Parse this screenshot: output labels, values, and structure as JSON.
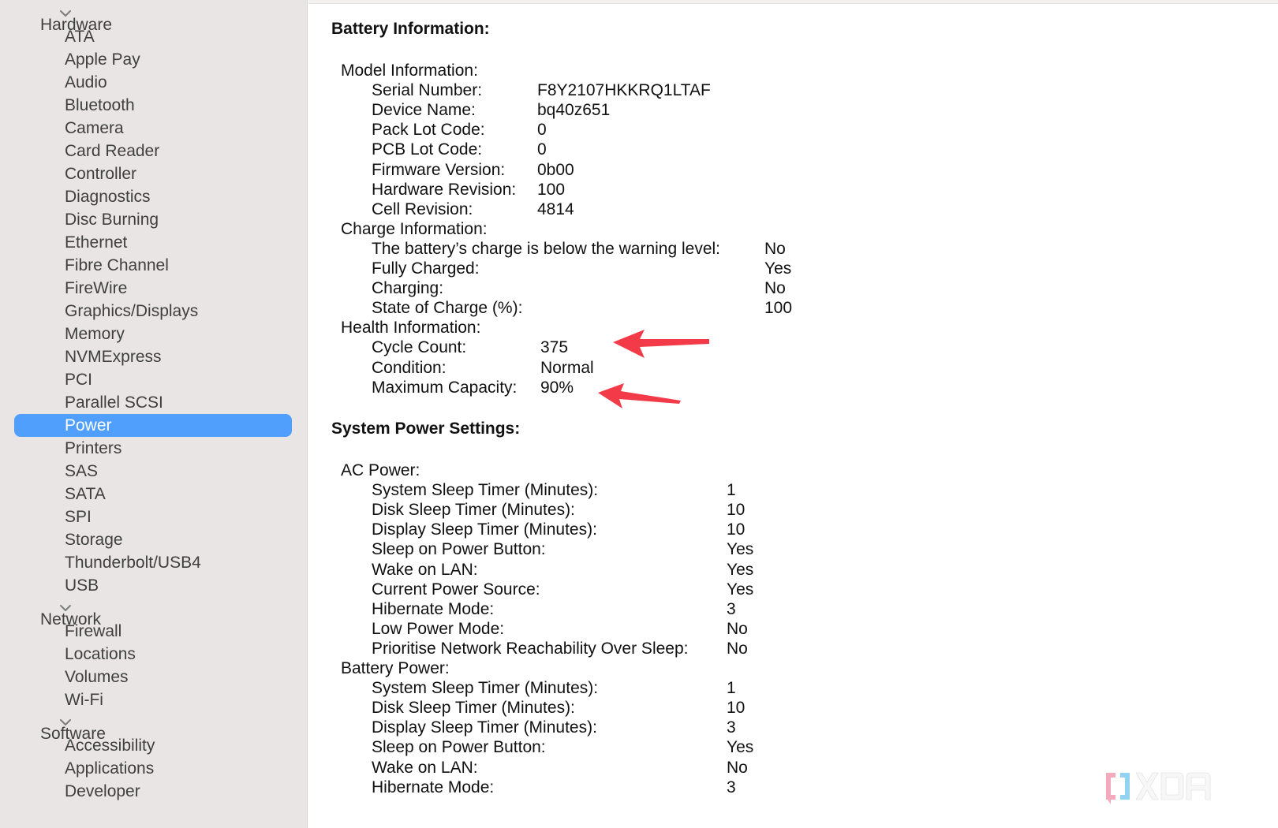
{
  "sidebar": {
    "groups": [
      {
        "label": "Hardware",
        "expanded": true,
        "items": [
          "ATA",
          "Apple Pay",
          "Audio",
          "Bluetooth",
          "Camera",
          "Card Reader",
          "Controller",
          "Diagnostics",
          "Disc Burning",
          "Ethernet",
          "Fibre Channel",
          "FireWire",
          "Graphics/Displays",
          "Memory",
          "NVMExpress",
          "PCI",
          "Parallel SCSI",
          "Power",
          "Printers",
          "SAS",
          "SATA",
          "SPI",
          "Storage",
          "Thunderbolt/USB4",
          "USB"
        ]
      },
      {
        "label": "Network",
        "expanded": true,
        "items": [
          "Firewall",
          "Locations",
          "Volumes",
          "Wi-Fi"
        ]
      },
      {
        "label": "Software",
        "expanded": true,
        "items": [
          "Accessibility",
          "Applications",
          "Developer"
        ]
      }
    ],
    "selected": "Power",
    "selection_color": "#509ffc"
  },
  "battery": {
    "title": "Battery Information:",
    "model": {
      "heading": "Model Information:",
      "rows": [
        {
          "label": "Serial Number:",
          "value": "F8Y2107HKKRQ1LTAF"
        },
        {
          "label": "Device Name:",
          "value": "bq40z651"
        },
        {
          "label": "Pack Lot Code:",
          "value": "0"
        },
        {
          "label": "PCB Lot Code:",
          "value": "0"
        },
        {
          "label": "Firmware Version:",
          "value": "0b00"
        },
        {
          "label": "Hardware Revision:",
          "value": "100"
        },
        {
          "label": "Cell Revision:",
          "value": "4814"
        }
      ]
    },
    "charge": {
      "heading": "Charge Information:",
      "rows": [
        {
          "label": "The battery’s charge is below the warning level:",
          "value": "No"
        },
        {
          "label": "Fully Charged:",
          "value": "Yes"
        },
        {
          "label": "Charging:",
          "value": "No"
        },
        {
          "label": "State of Charge (%):",
          "value": "100"
        }
      ]
    },
    "health": {
      "heading": "Health Information:",
      "rows": [
        {
          "label": "Cycle Count:",
          "value": "375"
        },
        {
          "label": "Condition:",
          "value": "Normal"
        },
        {
          "label": "Maximum Capacity:",
          "value": "90%"
        }
      ]
    }
  },
  "power_settings": {
    "title": "System Power Settings:",
    "ac": {
      "heading": "AC Power:",
      "rows": [
        {
          "label": "System Sleep Timer (Minutes):",
          "value": "1"
        },
        {
          "label": "Disk Sleep Timer (Minutes):",
          "value": "10"
        },
        {
          "label": "Display Sleep Timer (Minutes):",
          "value": "10"
        },
        {
          "label": "Sleep on Power Button:",
          "value": "Yes"
        },
        {
          "label": "Wake on LAN:",
          "value": "Yes"
        },
        {
          "label": "Current Power Source:",
          "value": "Yes"
        },
        {
          "label": "Hibernate Mode:",
          "value": "3"
        },
        {
          "label": "Low Power Mode:",
          "value": "No"
        },
        {
          "label": "Prioritise Network Reachability Over Sleep:",
          "value": "No"
        }
      ]
    },
    "battery": {
      "heading": "Battery Power:",
      "rows": [
        {
          "label": "System Sleep Timer (Minutes):",
          "value": "1"
        },
        {
          "label": "Disk Sleep Timer (Minutes):",
          "value": "10"
        },
        {
          "label": "Display Sleep Timer (Minutes):",
          "value": "3"
        },
        {
          "label": "Sleep on Power Button:",
          "value": "Yes"
        },
        {
          "label": "Wake on LAN:",
          "value": "No"
        },
        {
          "label": "Hibernate Mode:",
          "value": "3"
        }
      ]
    }
  },
  "annotations": {
    "arrow_color": "#f23a48",
    "targets": [
      "Cycle Count",
      "Maximum Capacity"
    ]
  },
  "watermark": {
    "text": "XDA",
    "bracket_left_color": "#f4a9bd",
    "bracket_right_color": "#93d3f2"
  }
}
